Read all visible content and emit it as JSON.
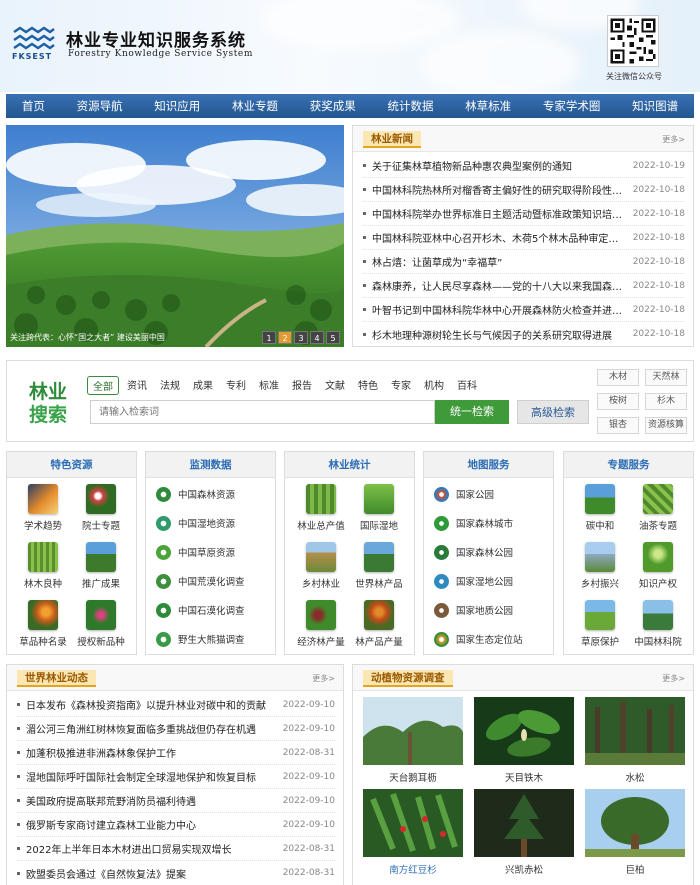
{
  "header": {
    "logo_abbr": "FKSEST",
    "title": "林业专业知识服务系统",
    "subtitle": "Forestry Knowledge Service System",
    "qr_caption": "关注微信公众号"
  },
  "nav": [
    "首页",
    "资源导航",
    "知识应用",
    "林业专题",
    "获奖成果",
    "统计数据",
    "林草标准",
    "专家学术圈",
    "知识图谱"
  ],
  "banner": {
    "caption": "关注跨代表：心怀“国之大者” 建设美丽中国",
    "pages": [
      "1",
      "2",
      "3",
      "4",
      "5"
    ],
    "active_page": 2
  },
  "forestry_news": {
    "title": "林业新闻",
    "more": "更多>",
    "items": [
      {
        "title": "关于征集林草植物新品种惠农典型案例的通知",
        "date": "2022-10-19"
      },
      {
        "title": "中国林科院热林所对榴香寄主偏好性的研究取得阶段性进展",
        "date": "2022-10-18"
      },
      {
        "title": "中国林科院举办世界标准日主题活动暨标准政策知识培训会",
        "date": "2022-10-18"
      },
      {
        "title": "中国林科院亚林中心召开杉木、木荷5个林木品种审定现场会",
        "date": "2022-10-18"
      },
      {
        "title": "林占熺：让菌草成为“幸福草”",
        "date": "2022-10-18"
      },
      {
        "title": "森林康养，让人民尽享森林——党的十八大以来我国森林康养",
        "date": "2022-10-18"
      },
      {
        "title": "叶智书记到中国林科院华林中心开展森林防火检查并进行调研",
        "date": "2022-10-18"
      },
      {
        "title": "杉木地理种源树轮生长与气候因子的关系研究取得进展",
        "date": "2022-10-18"
      }
    ]
  },
  "search": {
    "logo_line1": "林业",
    "logo_line2": "搜索",
    "tabs": [
      "全部",
      "资讯",
      "法规",
      "成果",
      "专利",
      "标准",
      "报告",
      "文献",
      "特色",
      "专家",
      "机构",
      "百科"
    ],
    "placeholder": "请输入检索词",
    "search_button": "统一检索",
    "advanced_button": "高级检索",
    "keywords": [
      "木材",
      "天然林",
      "桉树",
      "杉木",
      "银杏",
      "资源核算"
    ]
  },
  "categories": [
    {
      "title": "特色资源",
      "tiles": [
        "学术趋势",
        "院士专题",
        "林木良种",
        "推广成果",
        "草品种名录",
        "授权新品种"
      ]
    },
    {
      "title": "监测数据",
      "links": [
        "中国森林资源",
        "中国湿地资源",
        "中国草原资源",
        "中国荒漠化调查",
        "中国石漠化调查",
        "野生大熊猫调查"
      ]
    },
    {
      "title": "林业统计",
      "tiles": [
        "林业总产值",
        "国际湿地",
        "乡村林业",
        "世界林产品",
        "经济林产量",
        "林产品产量"
      ]
    },
    {
      "title": "地图服务",
      "links": [
        "国家公园",
        "国家森林城市",
        "国家森林公园",
        "国家湿地公园",
        "国家地质公园",
        "国家生态定位站"
      ]
    },
    {
      "title": "专题服务",
      "tiles": [
        "碳中和",
        "油茶专题",
        "乡村振兴",
        "知识产权",
        "草原保护",
        "中国林科院"
      ]
    }
  ],
  "world_news": {
    "title": "世界林业动态",
    "more": "更多>",
    "items": [
      {
        "title": "日本发布《森林投资指南》以提升林业对碳中和的贡献",
        "date": "2022-09-10"
      },
      {
        "title": "湄公河三角洲红树林恢复面临多重挑战但仍存在机遇",
        "date": "2022-09-10"
      },
      {
        "title": "加蓬积极推进非洲森林象保护工作",
        "date": "2022-08-31"
      },
      {
        "title": "湿地国际呼吁国际社会制定全球湿地保护和恢复目标",
        "date": "2022-09-10"
      },
      {
        "title": "美国政府提高联邦荒野消防员福利待遇",
        "date": "2022-09-10"
      },
      {
        "title": "俄罗斯专家商讨建立森林工业能力中心",
        "date": "2022-09-10"
      },
      {
        "title": "2022年上半年日本木材进出口贸易实现双增长",
        "date": "2022-08-31"
      },
      {
        "title": "欧盟委员会通过《自然恢复法》提案",
        "date": "2022-08-31"
      }
    ]
  },
  "animal_survey": {
    "title": "动植物资源调查",
    "more": "更多>",
    "items": [
      "天台鹅耳枥",
      "天目铁木",
      "水松",
      "南方红豆杉",
      "兴凯赤松",
      "巨柏"
    ],
    "highlight_index": 3
  },
  "colors": {
    "nav": "#2b5f9e",
    "accent_green": "#3f9a3a",
    "tag_bg": "#fbe7b3",
    "title_blue": "#2b6db5"
  }
}
